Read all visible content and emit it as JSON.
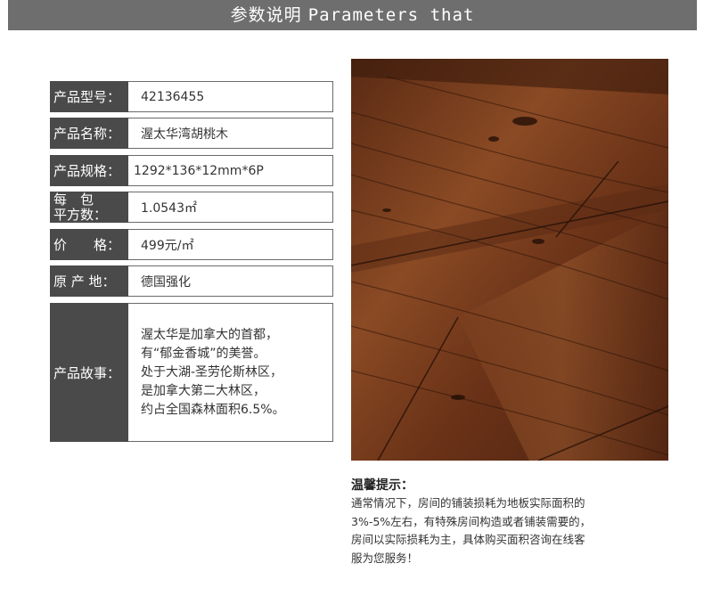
{
  "header": {
    "title_cn": "参数说明",
    "title_en": "Parameters that"
  },
  "params": [
    {
      "label": "产品型号：",
      "value": "42136455"
    },
    {
      "label": "产品名称：",
      "value": "渥太华湾胡桃木"
    },
    {
      "label": "产品规格：",
      "value": "1292*136*12mm*6P"
    },
    {
      "label_line1": "每　包",
      "label_line2": "平方数：",
      "value": "1.0543㎡"
    },
    {
      "label": "价　　格：",
      "value": "499元/㎡"
    },
    {
      "label": "原 产 地：",
      "value": "德国强化"
    }
  ],
  "story": {
    "label": "产品故事：",
    "lines": [
      "渥太华是加拿大的首都，",
      "有“郁金香城”的美誉。",
      "处于大湖-圣劳伦斯林区，",
      "是加拿大第二大林区，",
      "约占全国森林面积6.5%。"
    ]
  },
  "tip": {
    "title": "温馨提示：",
    "lines": [
      "通常情况下，房间的铺装损耗为地板实际面积的",
      "3%-5%左右，有特殊房间构造或者铺装需要的，",
      "房间以实际损耗为主，具体购买面积咨询在线客",
      "服为您服务！"
    ]
  },
  "colors": {
    "header_bg": "#6e6e6e",
    "label_bg": "#4a4a4a",
    "wood_dark": "#3a1a0c",
    "wood_mid": "#7a3f1f"
  }
}
